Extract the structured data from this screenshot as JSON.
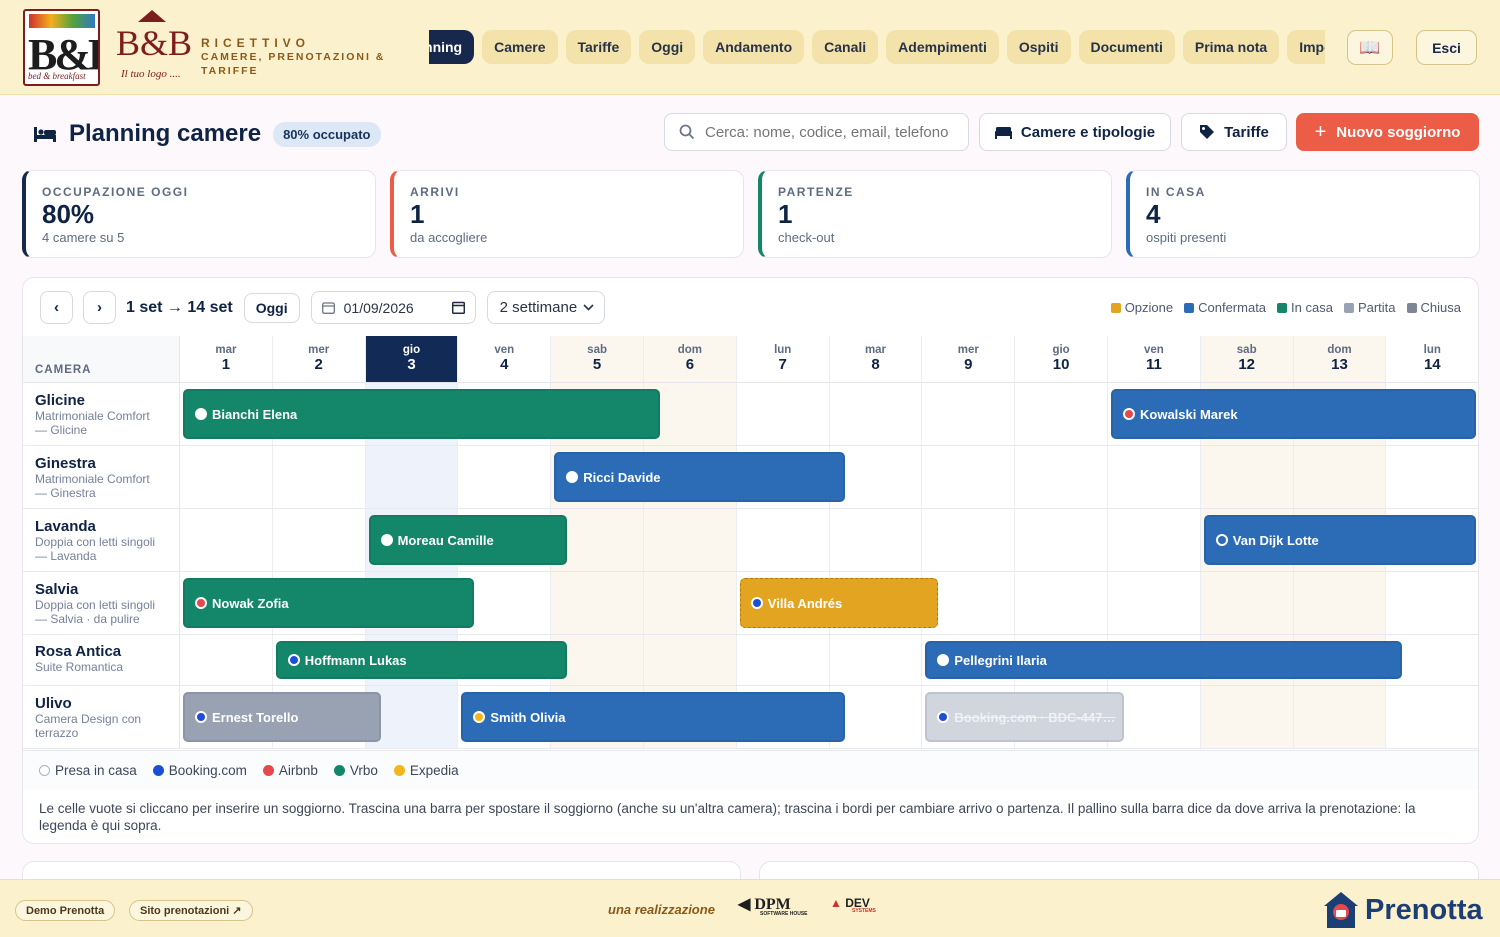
{
  "header": {
    "logo1_text": "B&B",
    "logo1_sub": "bed & breakfast",
    "logo2_text": "B&B",
    "logo2_tag": "Il tuo logo ....",
    "brand_line1": "RICETTIVO",
    "brand_line2": "CAMERE, PRENOTAZIONI &",
    "brand_line3": "TARIFFE",
    "nav": [
      {
        "label": "Planning",
        "active": true
      },
      {
        "label": "Camere"
      },
      {
        "label": "Tariffe"
      },
      {
        "label": "Oggi"
      },
      {
        "label": "Andamento"
      },
      {
        "label": "Canali"
      },
      {
        "label": "Adempimenti"
      },
      {
        "label": "Ospiti"
      },
      {
        "label": "Documenti"
      },
      {
        "label": "Prima nota"
      },
      {
        "label": "Impostazioni"
      }
    ],
    "book_icon": "📖",
    "logout_label": "Esci"
  },
  "page": {
    "title": "Planning camere",
    "occupancy_badge": "80% occupato",
    "search_placeholder": "Cerca: nome, codice, email, telefono",
    "btn_rooms": "Camere e tipologie",
    "btn_rates": "Tariffe",
    "btn_new": "Nuovo soggiorno"
  },
  "stats": [
    {
      "label": "OCCUPAZIONE OGGI",
      "value": "80%",
      "sub": "4 camere su 5",
      "color": "#17284c"
    },
    {
      "label": "ARRIVI",
      "value": "1",
      "sub": "da accogliere",
      "color": "#ec5d47"
    },
    {
      "label": "PARTENZE",
      "value": "1",
      "sub": "check-out",
      "color": "#14866a"
    },
    {
      "label": "IN CASA",
      "value": "4",
      "sub": "ospiti presenti",
      "color": "#2c6cb7"
    }
  ],
  "planner": {
    "range": "1 set → 14 set",
    "today_label": "Oggi",
    "date_value": "01/09/2026",
    "weeks_option": "2 settimane",
    "legend": [
      {
        "label": "Opzione",
        "color": "#e3a422"
      },
      {
        "label": "Confermata",
        "color": "#2c6cb7"
      },
      {
        "label": "In casa",
        "color": "#14866a"
      },
      {
        "label": "Partita",
        "color": "#98a2b3"
      },
      {
        "label": "Chiusa",
        "color": "#7d8596"
      }
    ],
    "camera_header": "CAMERA",
    "days": [
      {
        "d": "mar",
        "n": "1"
      },
      {
        "d": "mer",
        "n": "2"
      },
      {
        "d": "gio",
        "n": "3",
        "today": true
      },
      {
        "d": "ven",
        "n": "4"
      },
      {
        "d": "sab",
        "n": "5",
        "weekend": true
      },
      {
        "d": "dom",
        "n": "6",
        "weekend": true
      },
      {
        "d": "lun",
        "n": "7"
      },
      {
        "d": "mar",
        "n": "8"
      },
      {
        "d": "mer",
        "n": "9"
      },
      {
        "d": "gio",
        "n": "10"
      },
      {
        "d": "ven",
        "n": "11"
      },
      {
        "d": "sab",
        "n": "12",
        "weekend": true
      },
      {
        "d": "dom",
        "n": "13",
        "weekend": true
      },
      {
        "d": "lun",
        "n": "14"
      }
    ],
    "rooms": [
      {
        "name": "Glicine",
        "type": "Matrimoniale Comfort",
        "sub": "— Glicine"
      },
      {
        "name": "Ginestra",
        "type": "Matrimoniale Comfort",
        "sub": "— Ginestra"
      },
      {
        "name": "Lavanda",
        "type": "Doppia con letti singoli",
        "sub": "— Lavanda"
      },
      {
        "name": "Salvia",
        "type": "Doppia con letti singoli",
        "sub": "— Salvia · da pulire"
      },
      {
        "name": "Rosa Antica",
        "type": "Suite Romantica",
        "sub": ""
      },
      {
        "name": "Ulivo",
        "type": "Camera Design con",
        "sub": "terrazzo"
      }
    ],
    "bookings": [
      {
        "guest": "Bianchi Elena",
        "room": 0,
        "start": 1,
        "end": 6.2,
        "status": "g",
        "source": "#ffffff"
      },
      {
        "guest": "Kowalski Marek",
        "room": 0,
        "start": 11,
        "end": 15,
        "status": "b",
        "source": "#e5484d"
      },
      {
        "guest": "Ricci Davide",
        "room": 1,
        "start": 5,
        "end": 8.2,
        "status": "b",
        "source": "#ffffff"
      },
      {
        "guest": "Moreau Camille",
        "room": 2,
        "start": 3,
        "end": 5.2,
        "status": "g",
        "source": "#ffffff"
      },
      {
        "guest": "Van Dijk Lotte",
        "room": 2,
        "start": 12,
        "end": 15,
        "status": "b",
        "source": "#2c6cb7"
      },
      {
        "guest": "Nowak Zofia",
        "room": 3,
        "start": 1,
        "end": 4.2,
        "status": "g",
        "source": "#e5484d"
      },
      {
        "guest": "Villa Andrés",
        "room": 3,
        "start": 7,
        "end": 9.2,
        "status": "o",
        "source": "#1d4ed8"
      },
      {
        "guest": "Hoffmann Lukas",
        "room": 4,
        "start": 2,
        "end": 5.2,
        "status": "g",
        "source": "#1d4ed8"
      },
      {
        "guest": "Pellegrini Ilaria",
        "room": 4,
        "start": 9,
        "end": 14.2,
        "status": "b",
        "source": "#ffffff"
      },
      {
        "guest": "Ernest Torello",
        "room": 5,
        "start": 1,
        "end": 3.2,
        "status": "p",
        "source": "#1d4ed8"
      },
      {
        "guest": "Smith Olivia",
        "room": 5,
        "start": 4,
        "end": 8.2,
        "status": "b",
        "source": "#f5b51c"
      },
      {
        "guest": "Booking.com · BDC-447…",
        "room": 5,
        "start": 9,
        "end": 11.2,
        "status": "x",
        "source": "#1d4ed8"
      }
    ],
    "sources": [
      {
        "label": "Presa in casa",
        "color": "#ffffff"
      },
      {
        "label": "Booking.com",
        "color": "#1d4ed8"
      },
      {
        "label": "Airbnb",
        "color": "#e5484d"
      },
      {
        "label": "Vrbo",
        "color": "#14866a"
      },
      {
        "label": "Expedia",
        "color": "#f5b51c"
      }
    ],
    "help": "Le celle vuote si cliccano per inserire un soggiorno. Trascina una barra per spostare il soggiorno (anche su un'altra camera); trascina i bordi per cambiare arrivo o partenza. Il pallino sulla barra dice da dove arriva la prenotazione: la legenda è qui sopra."
  },
  "footer": {
    "demo_label": "Demo Prenotta",
    "site_label": "Sito prenotazioni ↗",
    "made_by": "una realizzazione",
    "partner1": "DPM",
    "partner1_sub": "SOFTWARE HOUSE",
    "partner2": "DEV",
    "partner2_sub": "SYSTEMS",
    "brand": "Prenotta"
  }
}
